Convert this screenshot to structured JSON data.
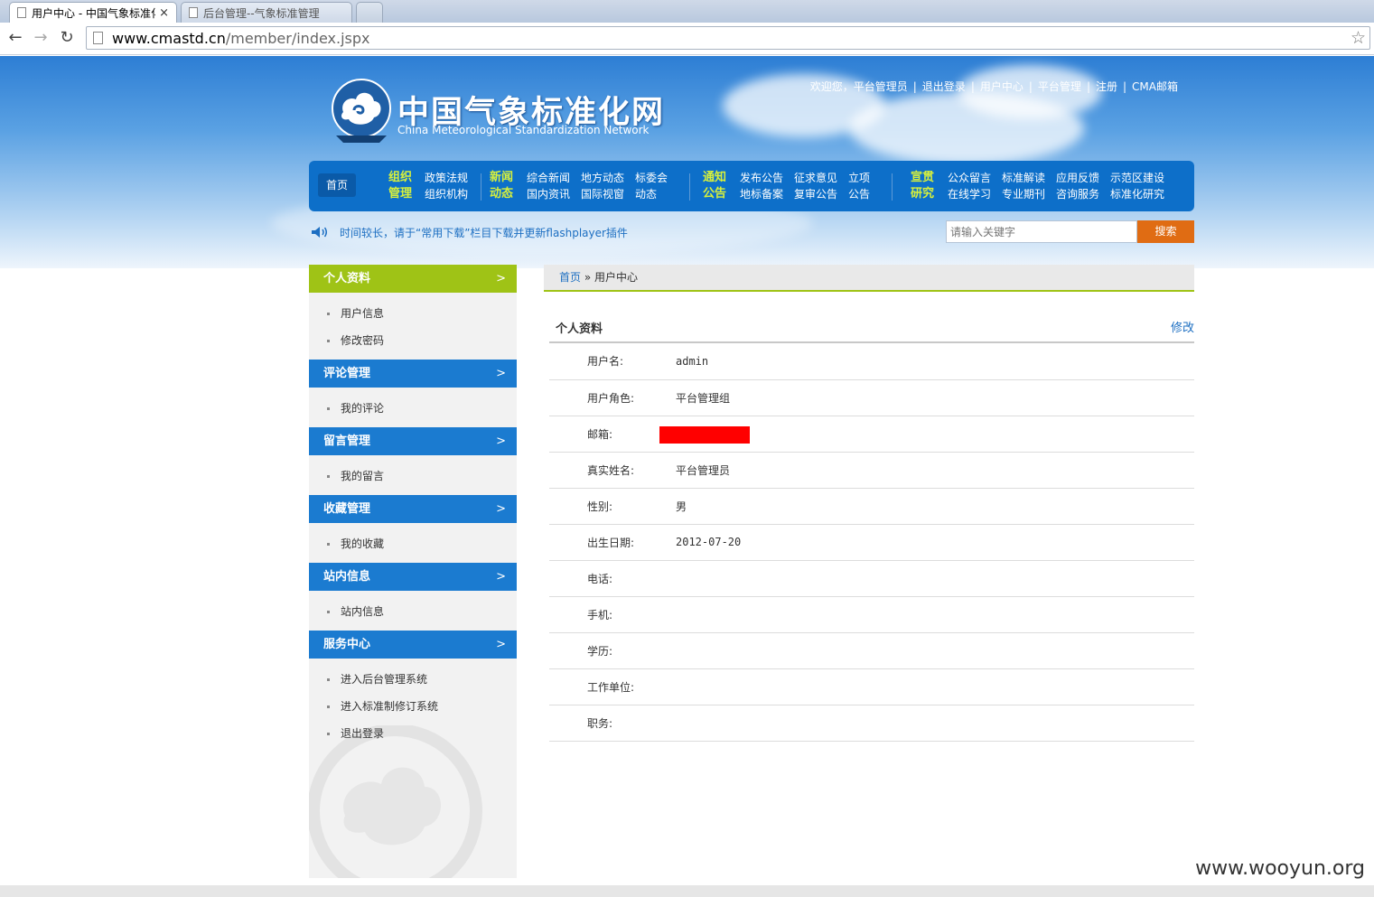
{
  "browser": {
    "tabs": [
      {
        "title": "用户中心 - 中国气象标准化",
        "close": "×"
      },
      {
        "title": "后台管理--气象标准管理"
      }
    ],
    "address_host": "www.cmastd.cn",
    "address_path": "/member/index.jspx"
  },
  "header": {
    "logo_cn": "中国气象标准化网",
    "logo_en": "China Meteorological Standardization Network",
    "toplinks": [
      "欢迎您，平台管理员",
      "退出登录",
      "用户中心",
      "平台管理",
      "注册",
      "CMA邮箱"
    ],
    "separator": "|"
  },
  "nav": {
    "home": "首页",
    "groups": [
      {
        "head": [
          "组织",
          "管理"
        ],
        "items": [
          [
            "政策法规",
            "组织机构"
          ]
        ]
      },
      {
        "head": [
          "新闻",
          "动态"
        ],
        "items": [
          [
            "综合新闻",
            "国内资讯"
          ],
          [
            "地方动态",
            "国际视窗"
          ],
          [
            "标委会",
            "动态"
          ]
        ]
      },
      {
        "head": [
          "通知",
          "公告"
        ],
        "items": [
          [
            "发布公告",
            "地标备案"
          ],
          [
            "征求意见",
            "复审公告"
          ],
          [
            "立项",
            "公告"
          ]
        ]
      },
      {
        "head": [
          "宣贯",
          "研究"
        ],
        "items": [
          [
            "公众留言",
            "在线学习"
          ],
          [
            "标准解读",
            "专业期刊"
          ],
          [
            "应用反馈",
            "咨询服务"
          ],
          [
            "示范区建设",
            "标准化研究"
          ]
        ]
      }
    ]
  },
  "notice": "时间较长，请于“常用下载”栏目下载并更新flashplayer插件",
  "search": {
    "placeholder": "请输入关键字",
    "button": "搜索"
  },
  "sidebar": {
    "sections": [
      {
        "title": "个人资料",
        "items": [
          "用户信息",
          "修改密码"
        ]
      },
      {
        "title": "评论管理",
        "items": [
          "我的评论"
        ]
      },
      {
        "title": "留言管理",
        "items": [
          "我的留言"
        ]
      },
      {
        "title": "收藏管理",
        "items": [
          "我的收藏"
        ]
      },
      {
        "title": "站内信息",
        "items": [
          "站内信息"
        ]
      },
      {
        "title": "服务中心",
        "items": [
          "进入后台管理系统",
          "进入标准制修订系统",
          "退出登录"
        ]
      }
    ],
    "chevron": ">"
  },
  "breadcrumb": {
    "home": "首页",
    "sep": "»",
    "current": "用户中心"
  },
  "profile": {
    "title": "个人资料",
    "edit": "修改",
    "fields": [
      {
        "label": "用户名:",
        "value": "admin"
      },
      {
        "label": "用户角色:",
        "value": "平台管理组"
      },
      {
        "label": "邮箱:",
        "value": ""
      },
      {
        "label": "真实姓名:",
        "value": "平台管理员"
      },
      {
        "label": "性别:",
        "value": "男"
      },
      {
        "label": "出生日期:",
        "value": "2012-07-20"
      },
      {
        "label": "电话:",
        "value": ""
      },
      {
        "label": "手机:",
        "value": ""
      },
      {
        "label": "学历:",
        "value": ""
      },
      {
        "label": "工作单位:",
        "value": ""
      },
      {
        "label": "职务:",
        "value": ""
      }
    ]
  },
  "watermark": "www.wooyun.org",
  "colors": {
    "nav_blue": "#0d6fc9",
    "accent_green": "#9fc316",
    "sidebar_blue": "#1b7bd0",
    "search_orange": "#e06c13",
    "link_blue": "#1d6fc2",
    "redaction": "#ff0000"
  }
}
